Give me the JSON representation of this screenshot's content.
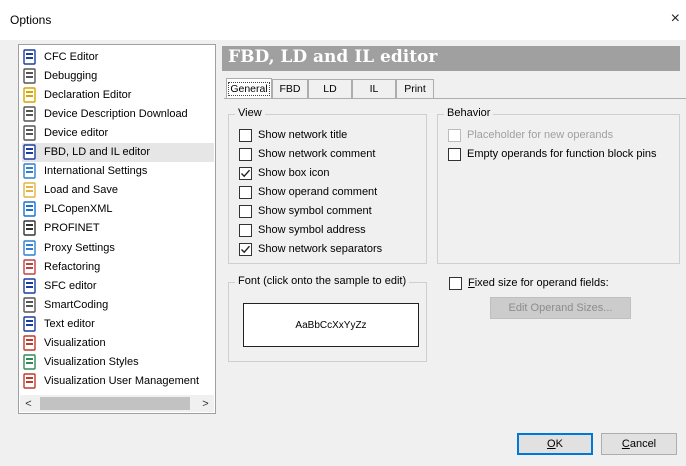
{
  "window": {
    "title": "Options",
    "close_glyph": "×"
  },
  "tree": {
    "items": [
      {
        "label": "CFC Editor",
        "icon": "cfc-editor-icon",
        "color": "#1a3d9e"
      },
      {
        "label": "Debugging",
        "icon": "debugging-icon",
        "color": "#555555"
      },
      {
        "label": "Declaration Editor",
        "icon": "declaration-editor-icon",
        "color": "#d9a400"
      },
      {
        "label": "Device Description Download",
        "icon": "device-download-icon",
        "color": "#555555"
      },
      {
        "label": "Device editor",
        "icon": "device-editor-icon",
        "color": "#555555"
      },
      {
        "label": "FBD, LD and IL editor",
        "icon": "fbd-ld-il-editor-icon",
        "color": "#1a3d9e",
        "selected": true
      },
      {
        "label": "International Settings",
        "icon": "globe-icon",
        "color": "#2f7fd1"
      },
      {
        "label": "Load and Save",
        "icon": "folder-icon",
        "color": "#e3b341"
      },
      {
        "label": "PLCopenXML",
        "icon": "plcopenxml-icon",
        "color": "#1a6fd1"
      },
      {
        "label": "PROFINET",
        "icon": "profinet-icon",
        "color": "#333333"
      },
      {
        "label": "Proxy Settings",
        "icon": "proxy-icon",
        "color": "#2f7fd1"
      },
      {
        "label": "Refactoring",
        "icon": "refactoring-icon",
        "color": "#c04040"
      },
      {
        "label": "SFC editor",
        "icon": "sfc-editor-icon",
        "color": "#1a3d9e"
      },
      {
        "label": "SmartCoding",
        "icon": "smartcoding-icon",
        "color": "#555555"
      },
      {
        "label": "Text editor",
        "icon": "text-editor-icon",
        "color": "#1a3d9e"
      },
      {
        "label": "Visualization",
        "icon": "visualization-icon",
        "color": "#c0392b"
      },
      {
        "label": "Visualization Styles",
        "icon": "visualization-styles-icon",
        "color": "#2e8b57"
      },
      {
        "label": "Visualization User Management",
        "icon": "user-management-icon",
        "color": "#c0392b"
      }
    ],
    "scroll_left": "<",
    "scroll_right": ">"
  },
  "panel": {
    "title": "FBD, LD and IL editor",
    "tabs": [
      "General",
      "FBD",
      "LD",
      "IL",
      "Print"
    ],
    "active_tab": "General",
    "view": {
      "legend": "View",
      "options": [
        {
          "label": "Show network title",
          "checked": false
        },
        {
          "label": "Show network comment",
          "checked": false
        },
        {
          "label": "Show box icon",
          "checked": true
        },
        {
          "label": "Show operand comment",
          "checked": false
        },
        {
          "label": "Show symbol comment",
          "checked": false
        },
        {
          "label": "Show symbol address",
          "checked": false
        },
        {
          "label": "Show network separators",
          "checked": true
        }
      ]
    },
    "behavior": {
      "legend": "Behavior",
      "options": [
        {
          "label": "Placeholder for new operands",
          "checked": false,
          "disabled": true
        },
        {
          "label": "Empty operands for function block pins",
          "checked": false,
          "disabled": false
        }
      ]
    },
    "font": {
      "legend": "Font (click onto the sample to edit)",
      "sample": "AaBbCcXxYyZz"
    },
    "fixed_size": {
      "accel": "F",
      "label_rest": "ixed size for operand fields:",
      "checked": false
    },
    "edit_sizes_button": "Edit Operand Sizes..."
  },
  "footer": {
    "ok_accel": "O",
    "ok_rest": "K",
    "cancel_accel": "C",
    "cancel_rest": "ancel"
  }
}
